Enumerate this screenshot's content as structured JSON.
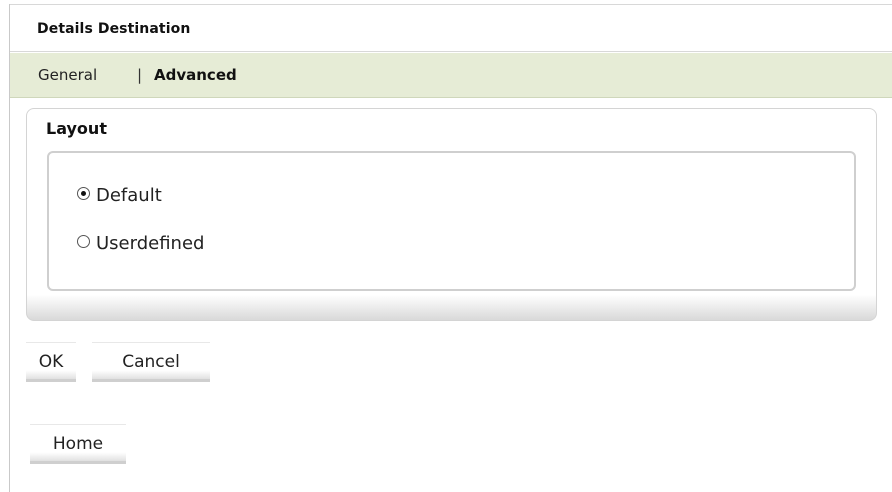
{
  "header": {
    "title": "Details Destination"
  },
  "tabs": {
    "general_label": "General",
    "separator": "|",
    "advanced_label": "Advanced",
    "active": "Advanced"
  },
  "layout_panel": {
    "title": "Layout",
    "options": [
      {
        "label": "Default",
        "selected": true
      },
      {
        "label": "Userdefined",
        "selected": false
      }
    ]
  },
  "actions": {
    "ok_label": "OK",
    "cancel_label": "Cancel",
    "home_label": "Home"
  },
  "colors": {
    "tabbar_background": "#e6ecd6",
    "text": "#222222"
  }
}
